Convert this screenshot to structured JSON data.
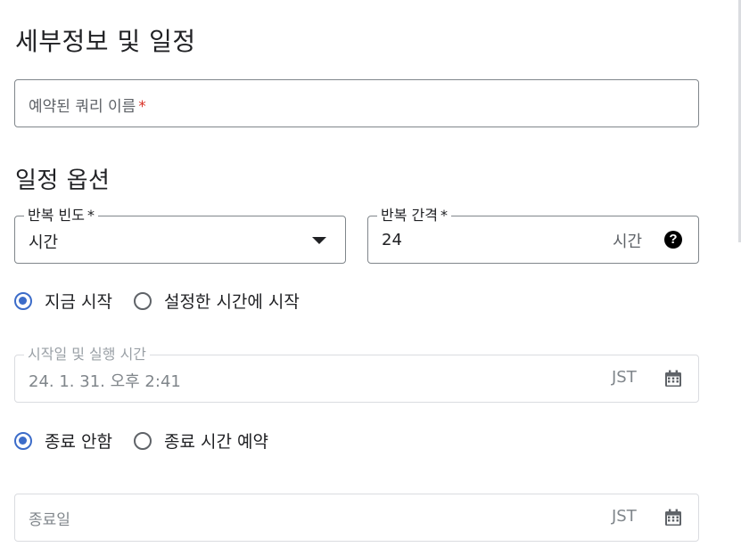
{
  "headings": {
    "details": "세부정보 및 일정",
    "schedule_options": "일정 옵션"
  },
  "query_name": {
    "placeholder": "예약된 쿼리 이름",
    "required_mark": "*"
  },
  "repeat_frequency": {
    "label": "반복 빈도",
    "required_mark": "*",
    "value": "시간"
  },
  "repeat_interval": {
    "label": "반복 간격",
    "required_mark": "*",
    "value": "24",
    "unit": "시간"
  },
  "start_radio": {
    "options": [
      "지금 시작",
      "설정한 시간에 시작"
    ],
    "selected": 0
  },
  "start_datetime": {
    "label": "시작일 및 실행 시간",
    "value": "24. 1. 31. 오후 2:41",
    "timezone": "JST"
  },
  "end_radio": {
    "options": [
      "종료 안함",
      "종료 시간 예약"
    ],
    "selected": 0
  },
  "end_date": {
    "placeholder": "종료일",
    "timezone": "JST"
  },
  "icons": {
    "dropdown": "caret-down-icon",
    "help": "help-circle-icon",
    "calendar": "calendar-icon"
  },
  "colors": {
    "accent": "#3c6cc9",
    "required": "#d93025"
  }
}
